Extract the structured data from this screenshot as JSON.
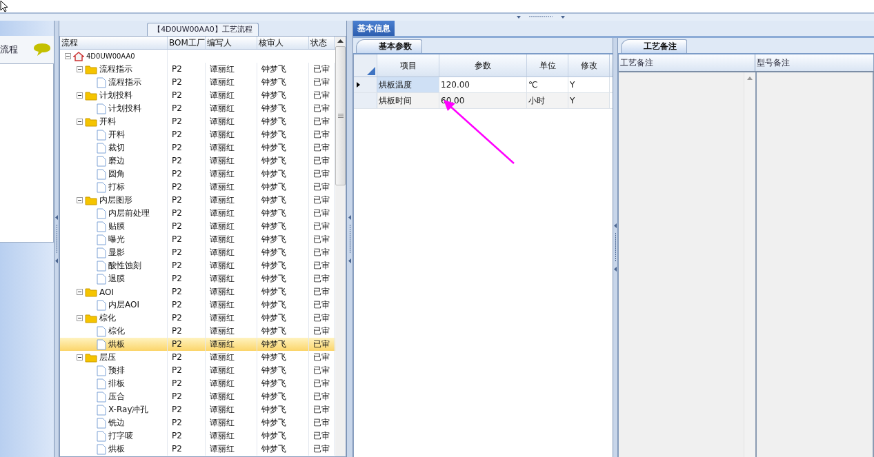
{
  "left_panel": {
    "title": "流程"
  },
  "tree_panel": {
    "title": "【4D0UW00AA0】工艺流程",
    "columns": [
      "流程",
      "BOM工厂",
      "编写人",
      "核审人",
      "状态"
    ],
    "tree": [
      {
        "kind": "root",
        "label": "4D0UW00AA0",
        "expanded": true,
        "selected": false,
        "children": [
          {
            "kind": "folder",
            "label": "流程指示",
            "expanded": true,
            "selected": false,
            "cells": [
              "P2",
              "谭丽红",
              "钟梦飞",
              "已审"
            ],
            "children": [
              {
                "kind": "file",
                "label": "流程指示",
                "selected": false,
                "cells": [
                  "P2",
                  "谭丽红",
                  "钟梦飞",
                  "已审"
                ]
              }
            ]
          },
          {
            "kind": "folder",
            "label": "计划投料",
            "expanded": true,
            "selected": false,
            "cells": [
              "P2",
              "谭丽红",
              "钟梦飞",
              "已审"
            ],
            "children": [
              {
                "kind": "file",
                "label": "计划投料",
                "selected": false,
                "cells": [
                  "P2",
                  "谭丽红",
                  "钟梦飞",
                  "已审"
                ]
              }
            ]
          },
          {
            "kind": "folder",
            "label": "开料",
            "expanded": true,
            "selected": false,
            "cells": [
              "P2",
              "谭丽红",
              "钟梦飞",
              "已审"
            ],
            "children": [
              {
                "kind": "file",
                "label": "开料",
                "selected": false,
                "cells": [
                  "P2",
                  "谭丽红",
                  "钟梦飞",
                  "已审"
                ]
              },
              {
                "kind": "file",
                "label": "裁切",
                "selected": false,
                "cells": [
                  "P2",
                  "谭丽红",
                  "钟梦飞",
                  "已审"
                ]
              },
              {
                "kind": "file",
                "label": "磨边",
                "selected": false,
                "cells": [
                  "P2",
                  "谭丽红",
                  "钟梦飞",
                  "已审"
                ]
              },
              {
                "kind": "file",
                "label": "圆角",
                "selected": false,
                "cells": [
                  "P2",
                  "谭丽红",
                  "钟梦飞",
                  "已审"
                ]
              },
              {
                "kind": "file",
                "label": "打标",
                "selected": false,
                "cells": [
                  "P2",
                  "谭丽红",
                  "钟梦飞",
                  "已审"
                ]
              }
            ]
          },
          {
            "kind": "folder",
            "label": "内层图形",
            "expanded": true,
            "selected": false,
            "cells": [
              "P2",
              "谭丽红",
              "钟梦飞",
              "已审"
            ],
            "children": [
              {
                "kind": "file",
                "label": "内层前处理",
                "selected": false,
                "cells": [
                  "P2",
                  "谭丽红",
                  "钟梦飞",
                  "已审"
                ]
              },
              {
                "kind": "file",
                "label": "贴膜",
                "selected": false,
                "cells": [
                  "P2",
                  "谭丽红",
                  "钟梦飞",
                  "已审"
                ]
              },
              {
                "kind": "file",
                "label": "曝光",
                "selected": false,
                "cells": [
                  "P2",
                  "谭丽红",
                  "钟梦飞",
                  "已审"
                ]
              },
              {
                "kind": "file",
                "label": "显影",
                "selected": false,
                "cells": [
                  "P2",
                  "谭丽红",
                  "钟梦飞",
                  "已审"
                ]
              },
              {
                "kind": "file",
                "label": "酸性蚀刻",
                "selected": false,
                "cells": [
                  "P2",
                  "谭丽红",
                  "钟梦飞",
                  "已审"
                ]
              },
              {
                "kind": "file",
                "label": "退膜",
                "selected": false,
                "cells": [
                  "P2",
                  "谭丽红",
                  "钟梦飞",
                  "已审"
                ]
              }
            ]
          },
          {
            "kind": "folder",
            "label": "AOI",
            "expanded": true,
            "selected": false,
            "cells": [
              "P2",
              "谭丽红",
              "钟梦飞",
              "已审"
            ],
            "children": [
              {
                "kind": "file",
                "label": "内层AOI",
                "selected": false,
                "cells": [
                  "P2",
                  "谭丽红",
                  "钟梦飞",
                  "已审"
                ]
              }
            ]
          },
          {
            "kind": "folder",
            "label": "棕化",
            "expanded": true,
            "selected": false,
            "cells": [
              "P2",
              "谭丽红",
              "钟梦飞",
              "已审"
            ],
            "children": [
              {
                "kind": "file",
                "label": "棕化",
                "selected": false,
                "cells": [
                  "P2",
                  "谭丽红",
                  "钟梦飞",
                  "已审"
                ]
              },
              {
                "kind": "file",
                "label": "烘板",
                "selected": true,
                "cells": [
                  "P2",
                  "谭丽红",
                  "钟梦飞",
                  "已审"
                ]
              }
            ]
          },
          {
            "kind": "folder",
            "label": "层压",
            "expanded": true,
            "selected": false,
            "cells": [
              "P2",
              "谭丽红",
              "钟梦飞",
              "已审"
            ],
            "children": [
              {
                "kind": "file",
                "label": "预排",
                "selected": false,
                "cells": [
                  "P2",
                  "谭丽红",
                  "钟梦飞",
                  "已审"
                ]
              },
              {
                "kind": "file",
                "label": "排板",
                "selected": false,
                "cells": [
                  "P2",
                  "谭丽红",
                  "钟梦飞",
                  "已审"
                ]
              },
              {
                "kind": "file",
                "label": "压合",
                "selected": false,
                "cells": [
                  "P2",
                  "谭丽红",
                  "钟梦飞",
                  "已审"
                ]
              },
              {
                "kind": "file",
                "label": "X-Ray冲孔",
                "selected": false,
                "cells": [
                  "P2",
                  "谭丽红",
                  "钟梦飞",
                  "已审"
                ]
              },
              {
                "kind": "file",
                "label": "铣边",
                "selected": false,
                "cells": [
                  "P2",
                  "谭丽红",
                  "钟梦飞",
                  "已审"
                ]
              },
              {
                "kind": "file",
                "label": "打字唛",
                "selected": false,
                "cells": [
                  "P2",
                  "谭丽红",
                  "钟梦飞",
                  "已审"
                ]
              },
              {
                "kind": "file",
                "label": "烘板",
                "selected": false,
                "cells": [
                  "P2",
                  "谭丽红",
                  "钟梦飞",
                  "已审"
                ]
              }
            ]
          }
        ]
      }
    ]
  },
  "detail": {
    "tabs": [
      {
        "label": "基本信息",
        "selected": true
      }
    ],
    "params": {
      "tab": {
        "label": "基本参数",
        "selected": true
      },
      "columns": [
        "项目",
        "参数",
        "单位",
        "修改"
      ],
      "rows": [
        {
          "selected": true,
          "cells": [
            "烘板温度",
            "120.00",
            "℃",
            "Y"
          ]
        },
        {
          "selected": false,
          "cells": [
            "烘板时间",
            "60.00",
            "小时",
            "Y"
          ]
        }
      ]
    },
    "notes": {
      "tab": {
        "label": "工艺备注",
        "selected": true
      },
      "columns": [
        "工艺备注",
        "型号备注"
      ]
    }
  }
}
